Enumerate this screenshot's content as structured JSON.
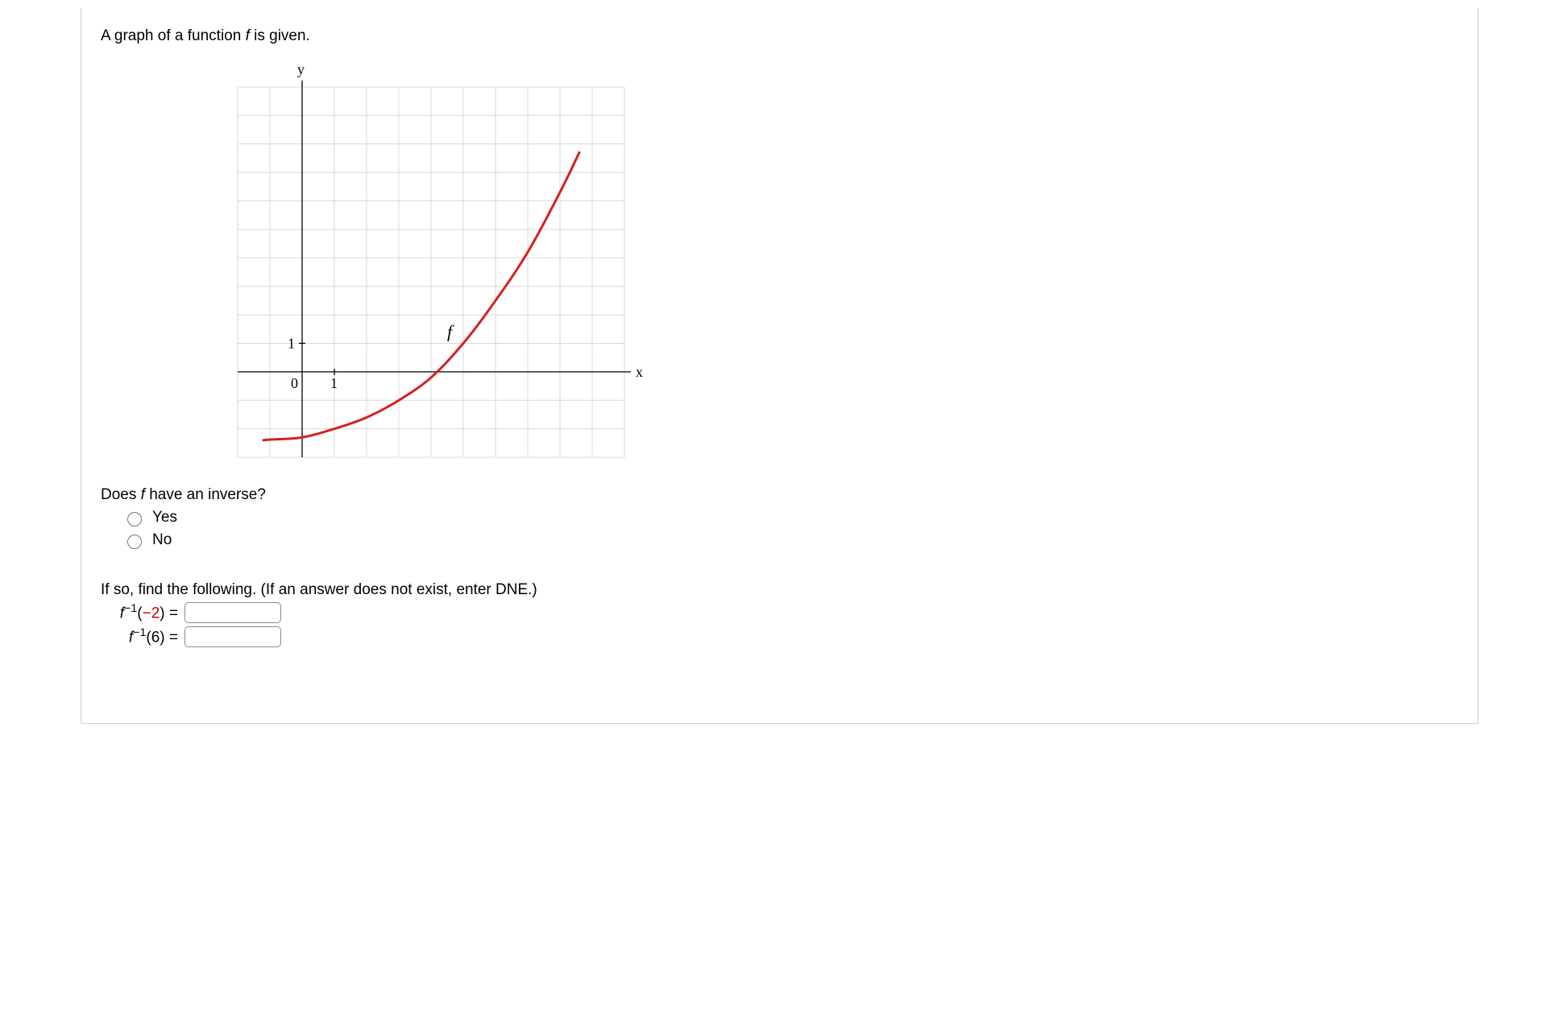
{
  "prompt_a": "A graph of a function ",
  "fn_name": "f",
  "prompt_b": " is given.",
  "inverse_q_a": "Does ",
  "inverse_q_b": " have an inverse?",
  "options": {
    "yes": "Yes",
    "no": "No"
  },
  "followup": "If so, find the following. (If an answer does not exist, enter DNE.)",
  "eq1": {
    "f": "f",
    "sup": "−1",
    "arg_open": "(",
    "neg": "−2",
    "arg_close": ")",
    "eq": " ="
  },
  "eq2": {
    "f": "f",
    "sup": "−1",
    "arg_open": "(",
    "val": "6",
    "arg_close": ")",
    "eq": " ="
  },
  "chart_data": {
    "type": "line",
    "title": "",
    "xlabel": "x",
    "ylabel": "y",
    "xlim": [
      -2,
      10
    ],
    "ylim": [
      -3,
      10
    ],
    "grid": true,
    "series": [
      {
        "name": "f",
        "color": "#d42020",
        "x": [
          -1.2,
          -1,
          0,
          1,
          2,
          3,
          4,
          5,
          6,
          7,
          8,
          8.6
        ],
        "y": [
          -2.4,
          -2.38,
          -2.3,
          -2.0,
          -1.6,
          -1.0,
          -0.2,
          1.0,
          2.5,
          4.2,
          6.3,
          7.7
        ]
      }
    ],
    "axis_ticks": {
      "x_label_at": 1,
      "y_label_at": 1,
      "origin_label": "0",
      "x_tick_label": "1",
      "y_tick_label": "1"
    },
    "curve_label": "f"
  }
}
